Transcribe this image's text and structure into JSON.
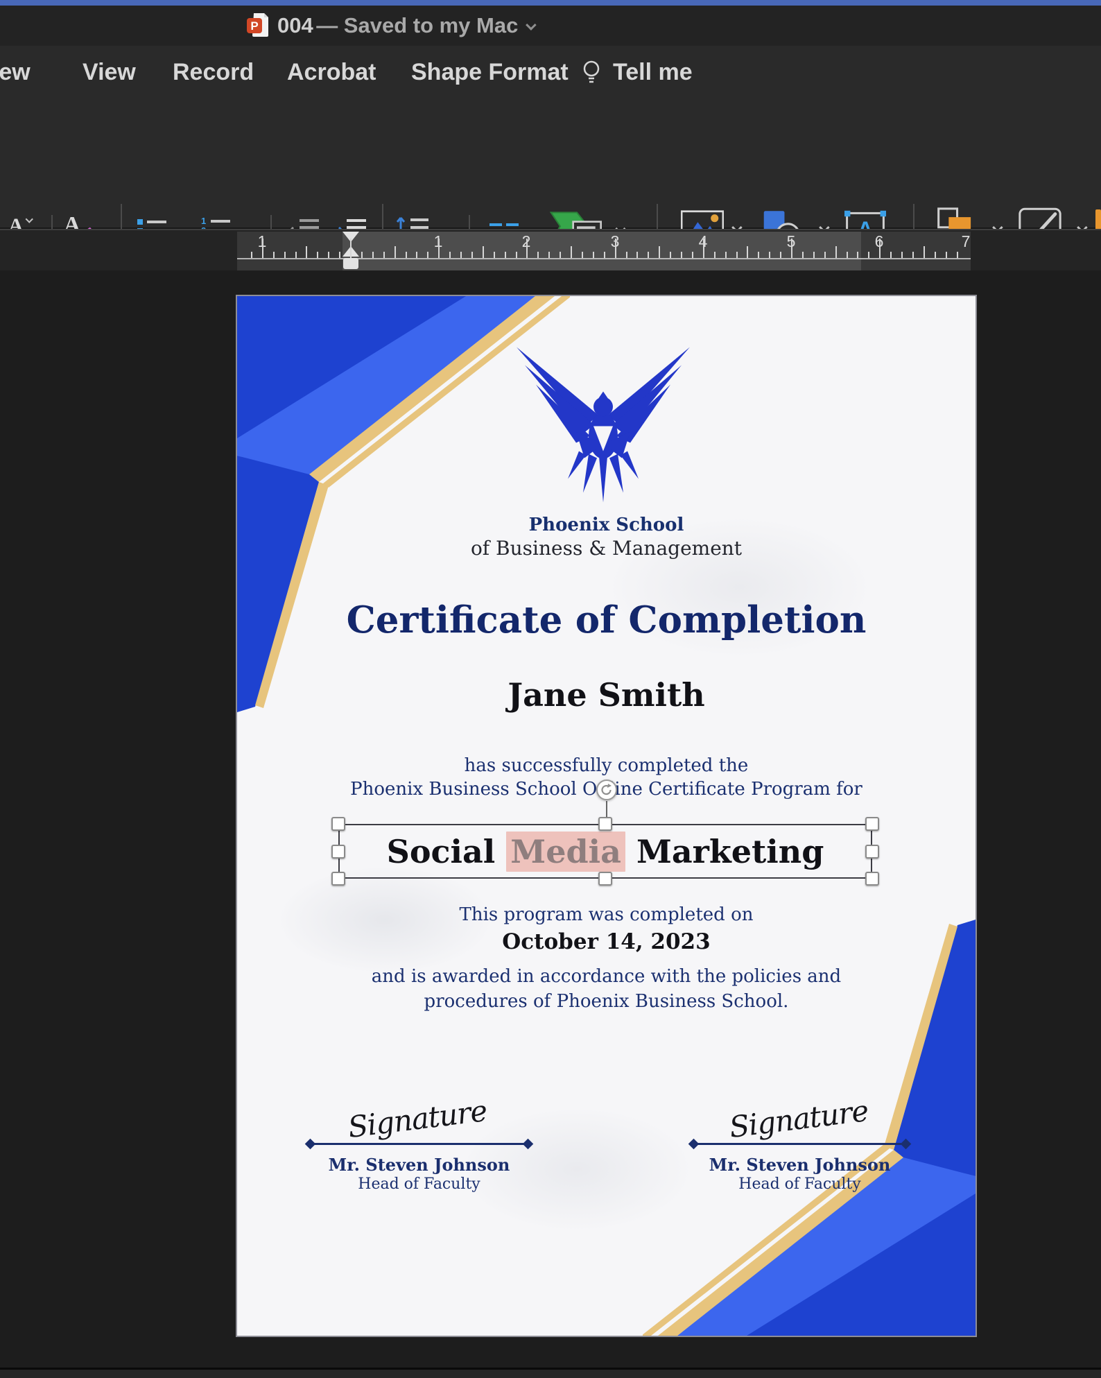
{
  "window": {
    "title_doc": "004",
    "title_rest": "— Saved to my Mac"
  },
  "menu": {
    "items": [
      "view",
      "View",
      "Record",
      "Acrobat",
      "Shape Format",
      "Tell me"
    ]
  },
  "ribbon": {
    "convert_to_smartart": "Convert to SmartArt",
    "picture": "Picture",
    "shapes": "Shapes",
    "text_box": "Text Box",
    "arrange": "Arrange",
    "quick_styles": "Quick Styles"
  },
  "ruler": {
    "marks": [
      "1",
      "1",
      "2",
      "3",
      "4",
      "5",
      "6",
      "7"
    ]
  },
  "slide": {
    "school_name": "Phoenix School",
    "school_sub": "of Business & Management",
    "title": "Certificate of Completion",
    "recipient": "Jane Smith",
    "line1": "has successfully completed the",
    "line2": "Phoenix Business School Online Certificate Program for",
    "program_before": "Social",
    "program_selected": "Media",
    "program_after": "Marketing",
    "completed_label": "This program was completed on",
    "date": "October 14, 2023",
    "closing1": "and is awarded in accordance with the policies and",
    "closing2": "procedures of Phoenix Business School.",
    "signature_script": "Signature",
    "signer_name": "Mr. Steven Johnson",
    "signer_role": "Head of Faculty"
  },
  "icons": {
    "app": "powerpoint-doc-icon",
    "tell_me": "lightbulb-icon",
    "logo": "phoenix-bird-logo"
  },
  "colors": {
    "top_strip": "#4868b8",
    "ribbon_bg": "#2a2a2a",
    "canvas_bg": "#1d1d1d",
    "slide_bg": "#f6f6f8",
    "navy_text": "#1b3070",
    "title_navy": "#13276b",
    "logo_blue": "#2337c8",
    "corner_blue_dark": "#1e42d0",
    "corner_blue_light": "#3c66ee",
    "corner_gold": "#e7c47d",
    "selection_pink": "#eec2bc",
    "accent_blue_icon": "#3ba0e8"
  }
}
